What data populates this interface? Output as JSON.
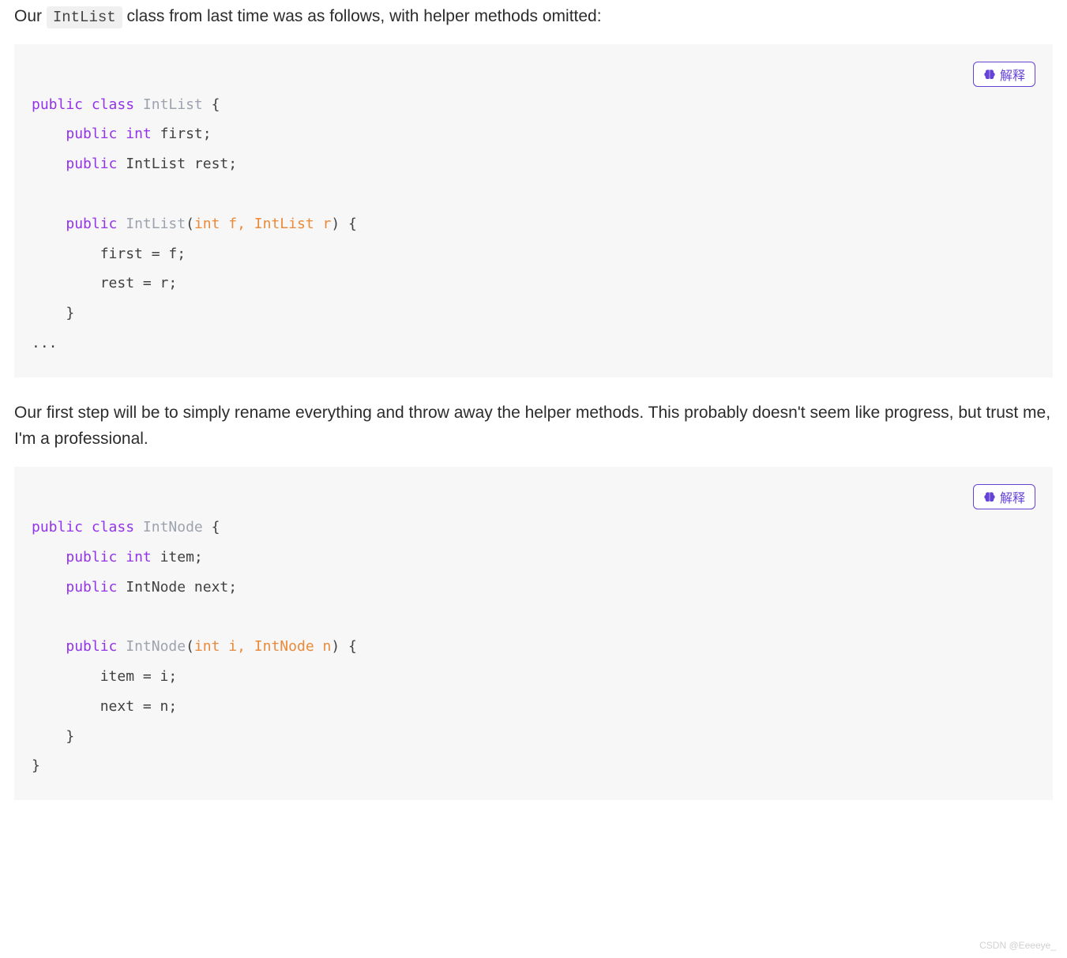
{
  "paragraph1": {
    "pre": "Our ",
    "code": "IntList",
    "post": " class from last time was as follows, with helper methods omitted:"
  },
  "paragraph2": "Our first step will be to simply rename everything and throw away the helper methods. This probably doesn't seem like progress, but trust me, I'm a professional.",
  "explainButtonLabel": "解释",
  "code1": {
    "l1a": "public",
    "l1b": " ",
    "l1c": "class",
    "l1d": " ",
    "l1e": "IntList",
    "l1f": " {",
    "l2a": "    ",
    "l2b": "public",
    "l2c": " ",
    "l2d": "int",
    "l2e": " first;",
    "l3a": "    ",
    "l3b": "public",
    "l3c": " IntList rest;",
    "l4": "",
    "l5a": "    ",
    "l5b": "public",
    "l5c": " ",
    "l5d": "IntList",
    "l5e": "(",
    "l5f": "int f, IntList r",
    "l5g": ")",
    "l5h": " {",
    "l6": "        first = f;",
    "l7": "        rest = r;",
    "l8": "    }",
    "l9": "..."
  },
  "code2": {
    "l1a": "public",
    "l1b": " ",
    "l1c": "class",
    "l1d": " ",
    "l1e": "IntNode",
    "l1f": " {",
    "l2a": "    ",
    "l2b": "public",
    "l2c": " ",
    "l2d": "int",
    "l2e": " item;",
    "l3a": "    ",
    "l3b": "public",
    "l3c": " IntNode next;",
    "l4": "",
    "l5a": "    ",
    "l5b": "public",
    "l5c": " ",
    "l5d": "IntNode",
    "l5e": "(",
    "l5f": "int i, IntNode n",
    "l5g": ")",
    "l5h": " {",
    "l6": "        item = i;",
    "l7": "        next = n;",
    "l8": "    }",
    "l9": "}"
  },
  "watermark": "CSDN @Eeeeye_"
}
